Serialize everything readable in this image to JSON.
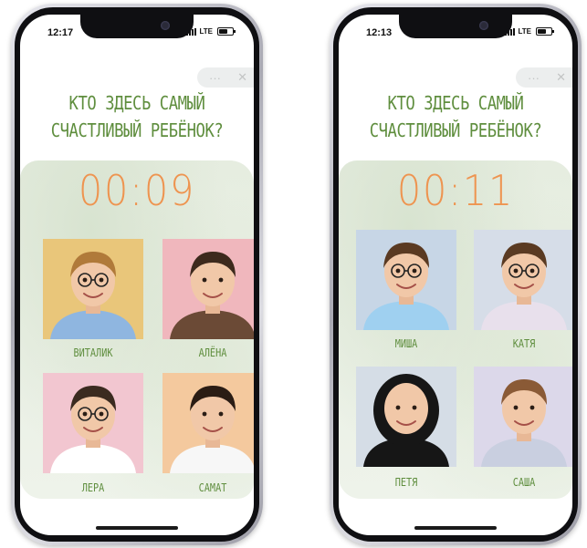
{
  "screens": [
    {
      "time": "12:17",
      "network": "LTE",
      "capsule": {
        "more": "···",
        "close": "✕"
      },
      "title_line1": "Кто здесь самый",
      "title_line2": "счастливый ребёнок?",
      "timer": "00:09",
      "children": [
        {
          "name": "Виталик",
          "bg": "#e9c67a",
          "shirt": "#8fb6e0",
          "hair": "#b07a3a",
          "glasses": true,
          "hood": false
        },
        {
          "name": "Алёна",
          "bg": "#f0b7bd",
          "shirt": "#6b4a36",
          "hair": "#3d2a1d",
          "glasses": false,
          "hood": false
        },
        {
          "name": "Лера",
          "bg": "#f2c6d0",
          "shirt": "#ffffff",
          "hair": "#3b2b20",
          "glasses": true,
          "hood": false
        },
        {
          "name": "Самат",
          "bg": "#f4c99e",
          "shirt": "#f7f7f7",
          "hair": "#2a1c14",
          "glasses": false,
          "hood": false
        }
      ]
    },
    {
      "time": "12:13",
      "network": "LTE",
      "capsule": {
        "more": "···",
        "close": "✕"
      },
      "title_line1": "Кто здесь самый",
      "title_line2": "счастливый ребёнок?",
      "timer": "00:11",
      "children": [
        {
          "name": "Миша",
          "bg": "#c7d6e6",
          "shirt": "#9fd0f0",
          "hair": "#5a3a22",
          "glasses": true,
          "hood": false
        },
        {
          "name": "Катя",
          "bg": "#d6dde8",
          "shirt": "#e8e0ec",
          "hair": "#5a3a22",
          "glasses": true,
          "hood": false
        },
        {
          "name": "Петя",
          "bg": "#d5dde6",
          "shirt": "#161616",
          "hair": "#161616",
          "glasses": false,
          "hood": true
        },
        {
          "name": "Саша",
          "bg": "#dcd8ea",
          "shirt": "#c9cfe0",
          "hair": "#8a5a36",
          "glasses": false,
          "hood": false
        }
      ]
    }
  ]
}
